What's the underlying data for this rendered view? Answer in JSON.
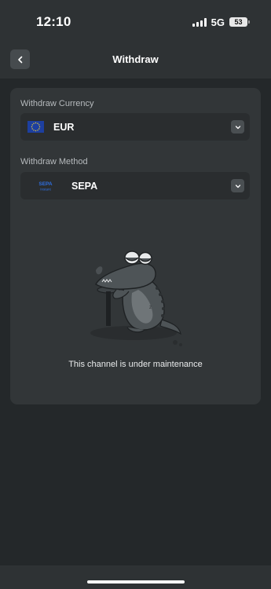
{
  "status_bar": {
    "time": "12:10",
    "network": "5G",
    "battery": "53"
  },
  "header": {
    "title": "Withdraw",
    "back_icon": "chevron-left-icon"
  },
  "withdraw_currency": {
    "label": "Withdraw Currency",
    "value": "EUR",
    "icon": "eu-flag-icon"
  },
  "withdraw_method": {
    "label": "Withdraw Method",
    "value": "SEPA",
    "logo_text": "SEPA",
    "logo_subtext": "Instant",
    "icon": "sepa-logo-icon"
  },
  "maintenance": {
    "message": "This channel is under maintenance",
    "illustration": "sleepy-crocodile-illustration"
  },
  "colors": {
    "background": "#24282a",
    "card": "#323638",
    "select": "#2a2d2f",
    "accent_button": "#464b4e"
  }
}
